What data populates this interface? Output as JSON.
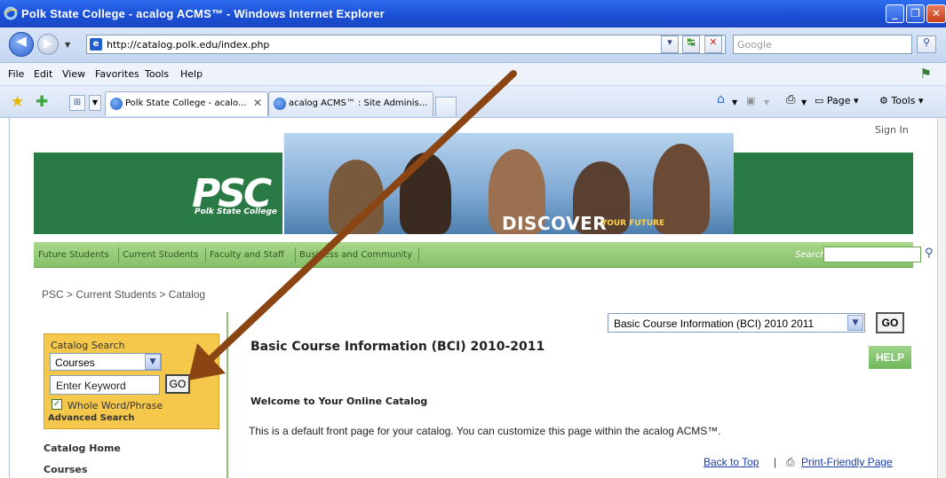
{
  "window": {
    "title": "Polk State College - acalog ACMS™ - Windows Internet Explorer"
  },
  "addressbar": {
    "url": "http://catalog.polk.edu/index.php",
    "search_placeholder": "Google"
  },
  "menubar": {
    "items": [
      "File",
      "Edit",
      "View",
      "Favorites",
      "Tools",
      "Help"
    ]
  },
  "tabs": [
    {
      "label": "Polk State College - acalo...",
      "active": true
    },
    {
      "label": "acalog ACMS™ : Site Adminis...",
      "active": false
    }
  ],
  "commandbar": {
    "page_label": "Page",
    "tools_label": "Tools"
  },
  "page": {
    "sign_in": "Sign In",
    "logo": {
      "text": "PSC",
      "subtitle": "Polk State College"
    },
    "banner": {
      "discover": "DISCOVER",
      "tagline": "YOUR FUTURE"
    },
    "nav": [
      "Future Students",
      "Current Students",
      "Faculty and Staff",
      "Business and Community"
    ],
    "nav_search_label": "Search",
    "breadcrumb": "PSC > Current Students > Catalog",
    "catalog_select": "Basic Course Information (BCI) 2010 2011",
    "go_label": "GO",
    "help_label": "HELP",
    "catalog_search": {
      "title": "Catalog Search",
      "scope": "Courses",
      "keyword_placeholder": "Enter Keyword",
      "go_label": "GO",
      "whole_word_label": "Whole Word/Phrase",
      "whole_word_checked": true,
      "advanced_link": "Advanced Search"
    },
    "side_links": [
      "Catalog Home",
      "Courses"
    ],
    "heading": "Basic Course Information (BCI) 2010-2011",
    "welcome": "Welcome to Your Online Catalog",
    "intro": "This is a default front page for your catalog. You can customize this page within the acalog ACMS™.",
    "back_to_top": "Back to Top",
    "separator": "|",
    "print_friendly": "Print-Friendly Page"
  },
  "colors": {
    "annotation_arrow": "#8b4513",
    "banner_green": "#2a7a46",
    "search_box_yellow": "#f5c84b"
  }
}
